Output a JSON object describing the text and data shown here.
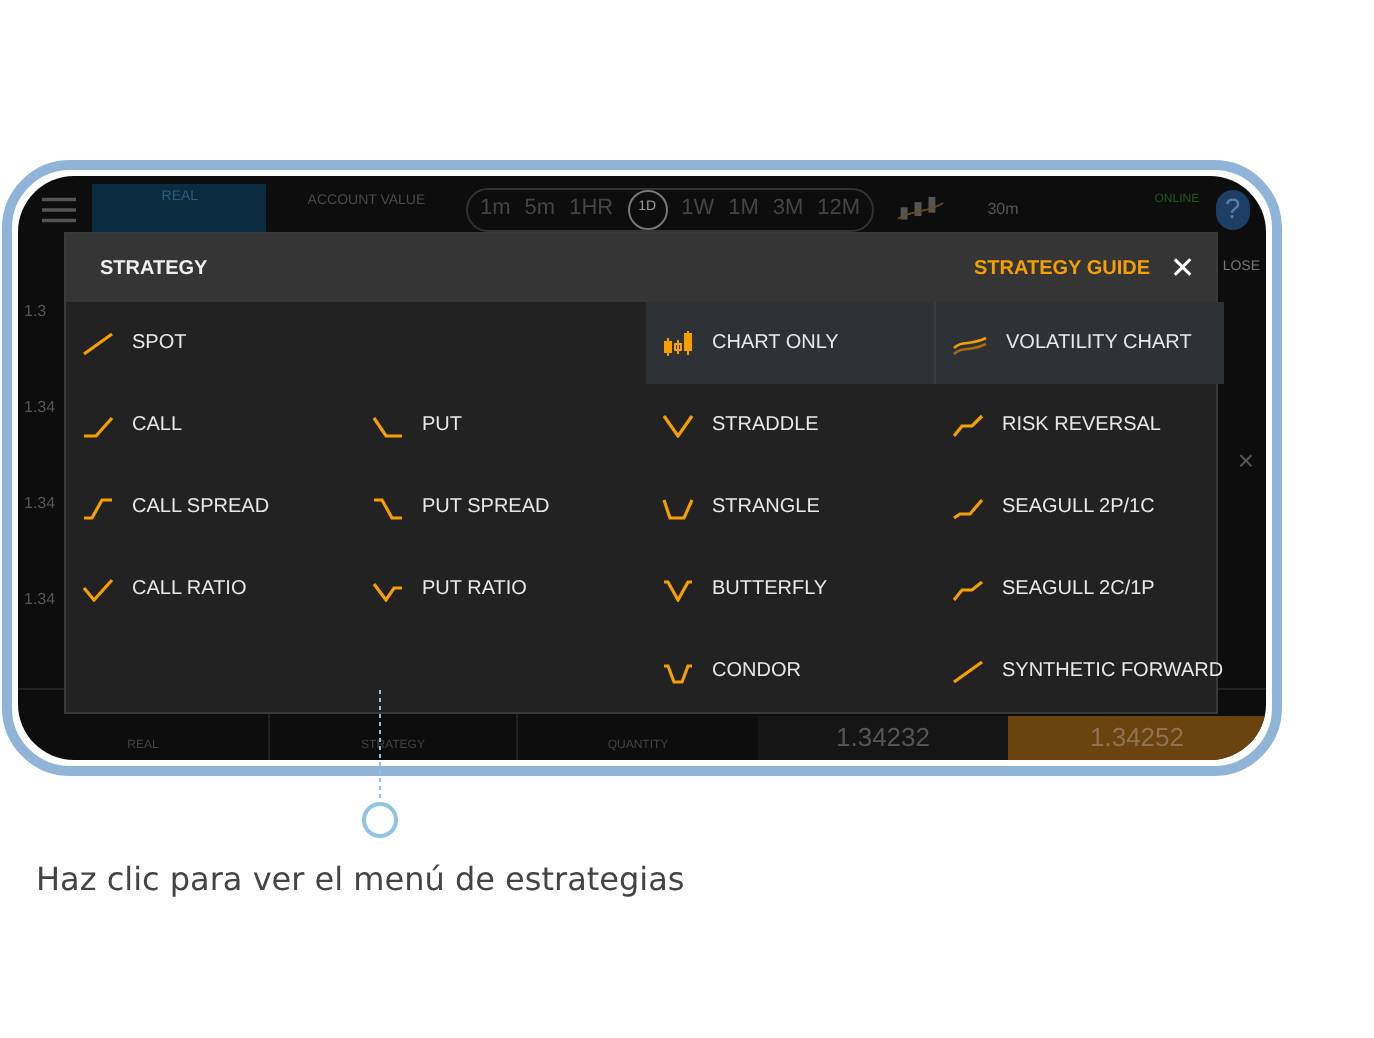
{
  "app": {
    "account": {
      "label": "REAL"
    },
    "account_value": {
      "label": "ACCOUNT VALUE"
    },
    "timeframes": [
      {
        "label": "1m",
        "selected": false
      },
      {
        "label": "5m",
        "selected": false
      },
      {
        "label": "1HR",
        "selected": false
      },
      {
        "label": "1D",
        "selected": true
      },
      {
        "label": "1W",
        "selected": false
      },
      {
        "label": "1M",
        "selected": false
      },
      {
        "label": "3M",
        "selected": false
      },
      {
        "label": "12M",
        "selected": false
      }
    ],
    "interval": "30m",
    "status": "ONLINE",
    "help": "?",
    "close_label": "LOSE",
    "side_close": "×",
    "prices": [
      "1.3",
      "1.34",
      "1.34",
      "1.34"
    ],
    "bottom": {
      "labels": [
        "REAL",
        "STRATEGY",
        "QUANTITY"
      ],
      "bid": "1.34232",
      "ask": "1.34252"
    }
  },
  "strategy_dialog": {
    "title": "STRATEGY",
    "guide_link": "STRATEGY GUIDE",
    "close": "✕",
    "rows": [
      [
        {
          "label": "SPOT",
          "selected": false
        },
        null,
        {
          "label": "CHART ONLY",
          "selected": true
        },
        {
          "label": "VOLATILITY CHART",
          "selected": true
        }
      ],
      [
        {
          "label": "CALL",
          "selected": false
        },
        {
          "label": "PUT",
          "selected": false
        },
        {
          "label": "STRADDLE",
          "selected": false
        },
        {
          "label": "RISK REVERSAL",
          "selected": false
        }
      ],
      [
        {
          "label": "CALL SPREAD",
          "selected": false
        },
        {
          "label": "PUT SPREAD",
          "selected": false
        },
        {
          "label": "STRANGLE",
          "selected": false
        },
        {
          "label": "SEAGULL 2P/1C",
          "selected": false
        }
      ],
      [
        {
          "label": "CALL RATIO",
          "selected": false
        },
        {
          "label": "PUT RATIO",
          "selected": false
        },
        {
          "label": "BUTTERFLY",
          "selected": false
        },
        {
          "label": "SEAGULL 2C/1P",
          "selected": false
        }
      ],
      [
        null,
        null,
        {
          "label": "CONDOR",
          "selected": false
        },
        {
          "label": "SYNTHETIC FORWARD",
          "selected": false
        }
      ]
    ]
  },
  "caption": "Haz clic para ver el menú de estrategias"
}
